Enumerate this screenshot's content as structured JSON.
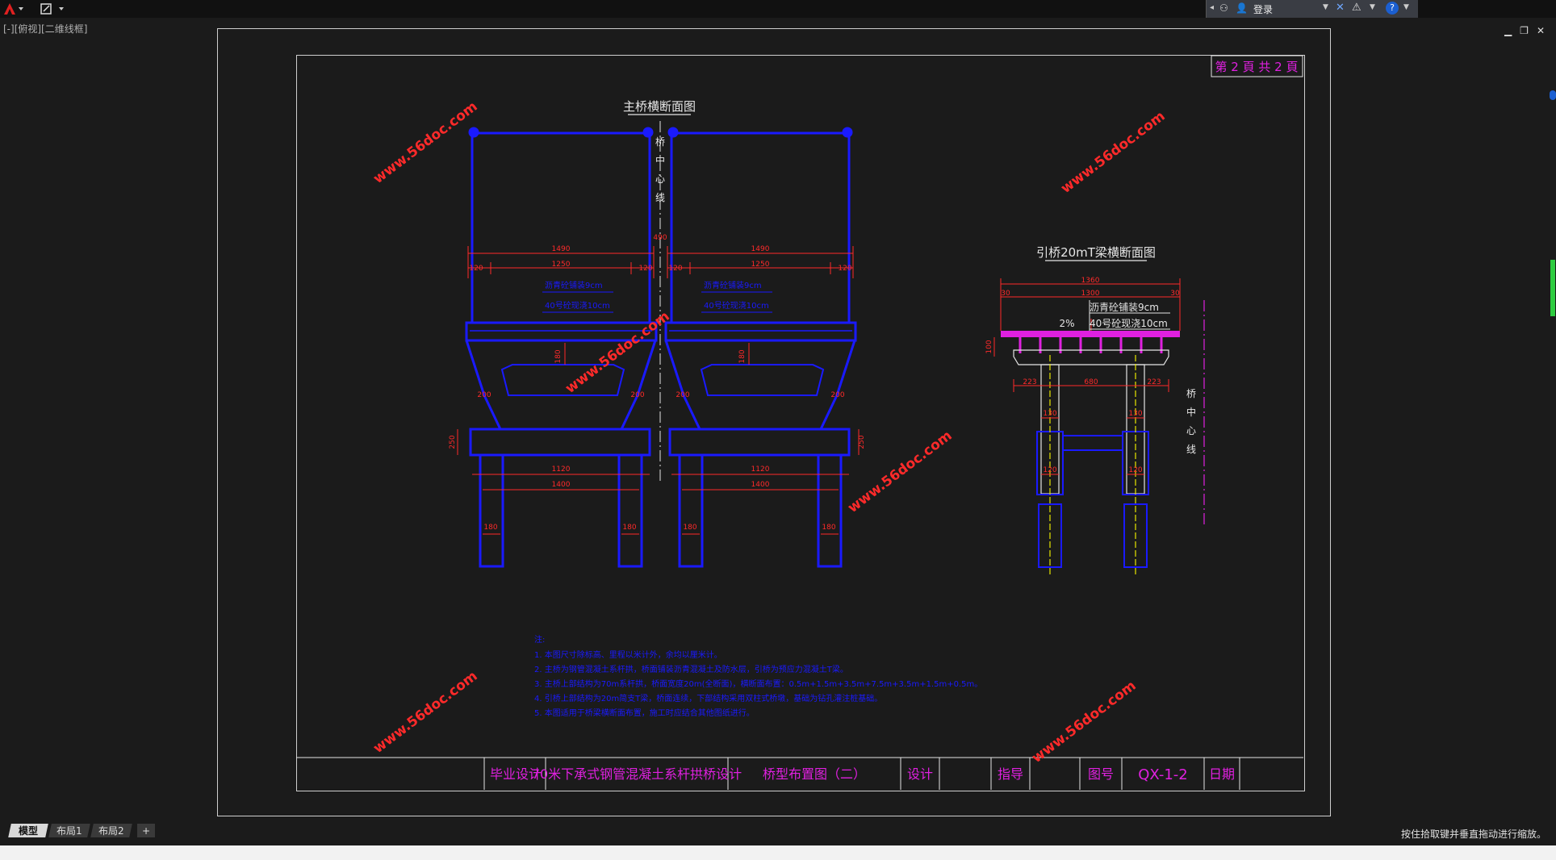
{
  "toolbar": {
    "login_label": "登录",
    "app_icon": "autocad-logo-icon",
    "help_icon": "help-icon"
  },
  "viewport_label": "[-][俯视][二维线框]",
  "window_controls": [
    "minimize-icon",
    "restore-icon",
    "close-icon"
  ],
  "drawing": {
    "page_label": "第 2 頁   共 2 頁",
    "main_title": "主桥横断面图",
    "approach_title": "引桥20mT梁横断面图",
    "centerline_label": "桥中心线",
    "centerline_label2": "桥中心线",
    "watermark": "www.56doc.com",
    "dims": {
      "d1490": "1490",
      "d1250": "1250",
      "d120": "120",
      "d490": "490",
      "d180": "180",
      "d200": "200",
      "d250": "250",
      "d1120": "1120",
      "d1400": "1400",
      "layer1": "沥青砼铺装9cm",
      "layer2": "40号砼现浇10cm",
      "a1360": "1360",
      "a1300": "1300",
      "a30": "30",
      "a_layer1": "沥青砼铺装9cm",
      "a_layer2": "40号砼现浇10cm",
      "slope": "2%",
      "a680": "680",
      "a223": "223",
      "a130": "130",
      "a100": "100"
    },
    "notes": {
      "heading": "注:",
      "lines": [
        "1. 本图尺寸除标高、里程以米计外，余均以厘米计。",
        "2. 主桥为钢管混凝土系杆拱，桥面铺装沥青混凝土及防水层，引桥为预应力混凝土T梁。",
        "3. 主桥上部结构为70m系杆拱，桥面宽度20m(全断面)，横断面布置：0.5m+1.5m+3.5m+7.5m+3.5m+1.5m+0.5m。",
        "4. 引桥上部结构为20m简支T梁，桥面连续，下部结构采用双柱式桥墩，基础为钻孔灌注桩基础。",
        "5. 本图适用于桥梁横断面布置，施工时应结合其他图纸进行。"
      ]
    },
    "title_block": {
      "c1": "毕业设计",
      "c2": "70米下承式钢管混凝土系杆拱桥设计",
      "c3": "桥型布置图（二）",
      "c4": "设计",
      "c5": "指导",
      "c6": "图号",
      "c7": "QX-1-2",
      "c8": "日期"
    }
  },
  "tabs": [
    "模型",
    "布局1",
    "布局2",
    "+"
  ],
  "status_text": "按住拾取键并垂直拖动进行缩放。",
  "colors": {
    "blue": "#1a1aff",
    "red": "#ff2a2a",
    "magenta": "#e020e0",
    "yellow": "#e8e800",
    "white": "#e6e6e6"
  }
}
